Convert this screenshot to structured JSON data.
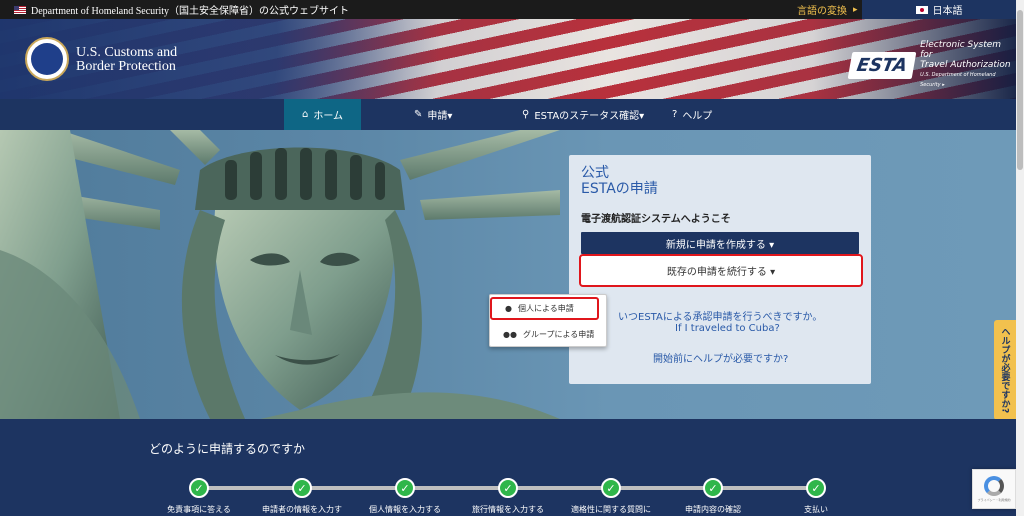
{
  "gov_bar": {
    "text": "Department of Homeland Security（国土安全保障省）の公式ウェブサイト",
    "lang_change": "言語の変換",
    "lang_change_arrow": "▸",
    "language": "日本語"
  },
  "header": {
    "cbp_line1": "U.S. Customs and",
    "cbp_line2": "Border Protection",
    "esta_logo": "ESTA",
    "esta_line1": "Electronic System for",
    "esta_line2": "Travel Authorization",
    "esta_line3": "U.S. Department of Homeland Security ▸"
  },
  "nav": {
    "home": "ホーム",
    "apply": "申請▾",
    "status": "ESTAのステータス確認▾",
    "help": "ヘルプ"
  },
  "panel": {
    "title_line1": "公式",
    "title_line2": "ESTAの申請",
    "welcome": "電子渡航認証システムへようこそ",
    "new_button": "新規に申請を作成する ▾",
    "continue_button": "既存の申請を続行する ▾",
    "q_when": "いつESTAによる承認申請を行うべきですか。",
    "q_cuba": "If I traveled to Cuba?",
    "q_help": "開始前にヘルプが必要ですか?"
  },
  "dropdown": {
    "individual": "個人による申請",
    "group": "グループによる申請"
  },
  "help_tab": "ヘルプが必要ですか?",
  "howto": {
    "title": "どのように申請するのですか",
    "steps": [
      {
        "label": "免責事項に答える"
      },
      {
        "label": "申請者の情報を入力す"
      },
      {
        "label": "個人情報を入力する"
      },
      {
        "label": "旅行情報を入力する"
      },
      {
        "label": "適格性に関する質問に"
      },
      {
        "label": "申請内容の確認"
      },
      {
        "label": "支払い"
      }
    ]
  },
  "recaptcha": {
    "text": "プライバシー・利用規約"
  },
  "colors": {
    "navy": "#1d3461",
    "teal": "#0e6685",
    "alert_red": "#e0161c",
    "step_green": "#2fb64a",
    "help_yellow": "#f2c14e"
  }
}
